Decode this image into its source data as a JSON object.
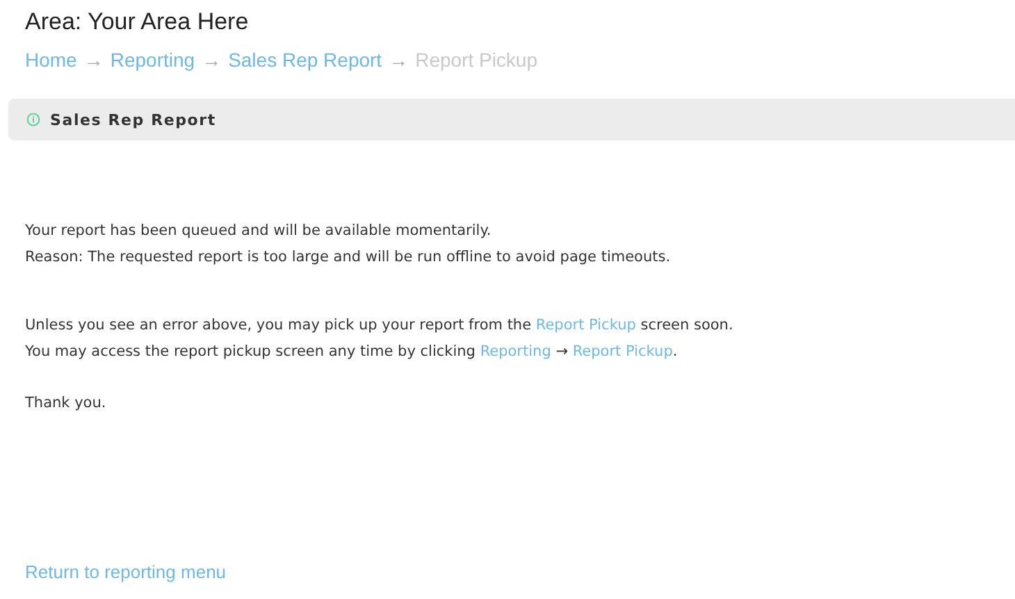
{
  "page": {
    "title": "Area: Your Area Here"
  },
  "breadcrumb": [
    {
      "label": "Home",
      "current": false,
      "separator": "→"
    },
    {
      "label": "Reporting",
      "current": false,
      "separator": "→"
    },
    {
      "label": "Sales Rep Report",
      "current": false,
      "separator": "→"
    },
    {
      "label": "Report Pickup",
      "current": true
    }
  ],
  "panel": {
    "title": "Sales Rep Report"
  },
  "message_groups": [
    [
      [
        {
          "kind": "text",
          "text": "Your report has been queued and will be available momentarily."
        }
      ],
      [
        {
          "kind": "text",
          "text": "Reason: The requested report is too large and will be run offline to avoid page timeouts."
        }
      ]
    ],
    [
      [
        {
          "kind": "text",
          "text": "Unless you see an error above, you may pick up your report from the "
        },
        {
          "kind": "link",
          "text": "Report Pickup"
        },
        {
          "kind": "text",
          "text": " screen soon."
        }
      ],
      [
        {
          "kind": "text",
          "text": "You may access the report pickup screen any time by clicking "
        },
        {
          "kind": "link",
          "text": "Reporting"
        },
        {
          "kind": "text",
          "text": " → "
        },
        {
          "kind": "link",
          "text": "Report Pickup"
        },
        {
          "kind": "text",
          "text": "."
        }
      ]
    ],
    [
      [
        {
          "kind": "text",
          "text": "Thank you."
        }
      ]
    ]
  ],
  "footer_link": "Return to reporting menu"
}
